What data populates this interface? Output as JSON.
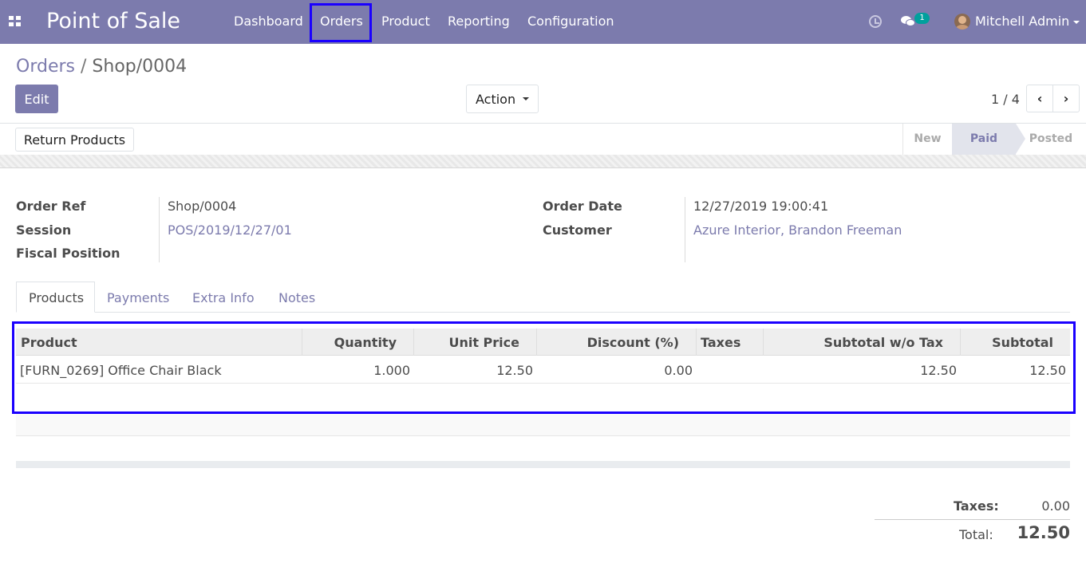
{
  "navbar": {
    "brand": "Point of Sale",
    "menu": [
      "Dashboard",
      "Orders",
      "Product",
      "Reporting",
      "Configuration"
    ],
    "chat_count": "1",
    "user": "Mitchell Admin",
    "color": "#7c7bad"
  },
  "breadcrumb": {
    "parent": "Orders",
    "separator": "/",
    "current": "Shop/0004"
  },
  "buttons": {
    "edit": "Edit",
    "action": "Action",
    "return_products": "Return Products"
  },
  "pager": {
    "value": "1 / 4",
    "prev": "‹",
    "next": "›"
  },
  "status": {
    "steps": [
      "New",
      "Paid",
      "Posted"
    ],
    "active": "Paid"
  },
  "form": {
    "order_ref_label": "Order Ref",
    "order_ref": "Shop/0004",
    "session_label": "Session",
    "session": "POS/2019/12/27/01",
    "fiscal_position_label": "Fiscal Position",
    "fiscal_position": "",
    "order_date_label": "Order Date",
    "order_date": "12/27/2019 19:00:41",
    "customer_label": "Customer",
    "customer": "Azure Interior, Brandon Freeman"
  },
  "tabs": [
    "Products",
    "Payments",
    "Extra Info",
    "Notes"
  ],
  "lines": {
    "headers": [
      "Product",
      "Quantity",
      "Unit Price",
      "Discount (%)",
      "Taxes",
      "Subtotal w/o Tax",
      "Subtotal"
    ],
    "rows": [
      {
        "product": "[FURN_0269] Office Chair Black",
        "quantity": "1.000",
        "unit_price": "12.50",
        "discount": "0.00",
        "taxes": "",
        "subtotal_wo_tax": "12.50",
        "subtotal": "12.50"
      }
    ]
  },
  "totals": {
    "taxes_label": "Taxes:",
    "taxes": "0.00",
    "total_label": "Total:",
    "total": "12.50"
  },
  "icons": {
    "apps": "apps-grid-icon",
    "clock": "clock-icon",
    "chat": "chat-icon",
    "prev": "chevron-left-icon",
    "next": "chevron-right-icon"
  },
  "colors": {
    "highlight": "#1a00ff",
    "badge": "#00a09d"
  }
}
